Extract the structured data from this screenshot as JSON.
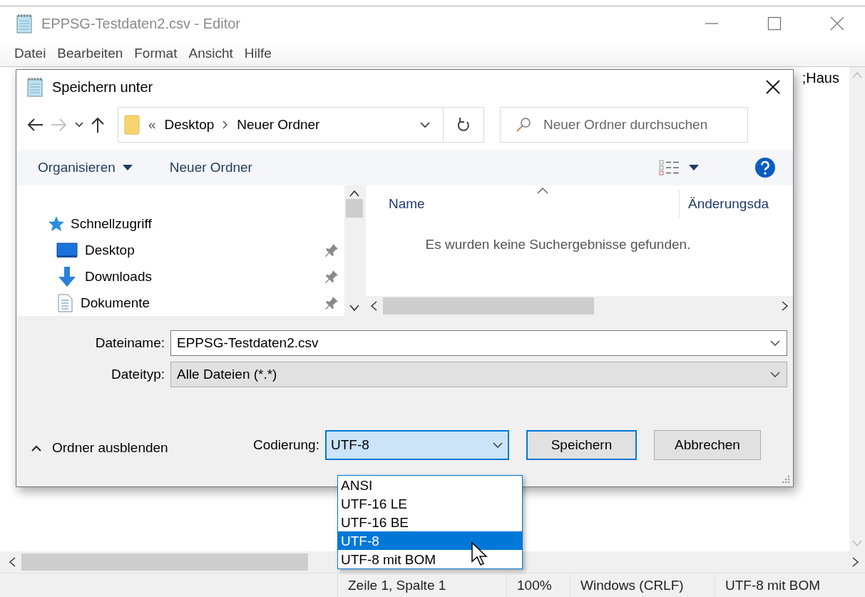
{
  "editor": {
    "title": "EPPSG-Testdaten2.csv - Editor",
    "menu": [
      "Datei",
      "Bearbeiten",
      "Format",
      "Ansicht",
      "Hilfe"
    ],
    "text": ";Haus",
    "status_bar": [
      "Zeile 1, Spalte 1",
      "100%",
      "Windows (CRLF)",
      "UTF-8 mit BOM"
    ]
  },
  "dialog": {
    "title": "Speichern unter",
    "nav_buttons": [
      {
        "kind": "back",
        "disabled": false
      },
      {
        "kind": "forward",
        "disabled": true
      },
      {
        "kind": "recent",
        "disabled": false
      },
      {
        "kind": "up",
        "disabled": false
      }
    ],
    "breadcrumb": {
      "overflow": "«",
      "parts": [
        "Desktop",
        "Neuer Ordner"
      ]
    },
    "search": {
      "placeholder": "Neuer Ordner durchsuchen"
    },
    "toolbar": [
      {
        "label": "Organisieren",
        "dropdown": true
      },
      {
        "label": "Neuer Ordner",
        "dropdown": false
      }
    ],
    "sidebar": {
      "items": [
        {
          "label": "Schnellzugriff",
          "kind": "star",
          "children": [
            {
              "label": "Desktop",
              "kind": "desktop",
              "pinned": true
            },
            {
              "label": "Downloads",
              "kind": "download",
              "pinned": true
            },
            {
              "label": "Dokumente",
              "kind": "document",
              "pinned": true
            }
          ]
        }
      ]
    },
    "file_list": {
      "columns": [
        "Name",
        "Änderungsda"
      ],
      "empty_message": "Es wurden keine Suchergebnisse gefunden."
    },
    "fields": [
      {
        "label": "Dateiname:",
        "value": "EPPSG-Testdaten2.csv",
        "kind": "edit"
      },
      {
        "label": "Dateityp:",
        "value": "Alle Dateien  (*.*)",
        "kind": "select"
      }
    ],
    "hide_folders": "Ordner ausblenden",
    "encoding": {
      "label": "Codierung:",
      "value": "UTF-8",
      "expanded": true,
      "options": [
        {
          "label": "ANSI",
          "selected": false
        },
        {
          "label": "UTF-16 LE",
          "selected": false
        },
        {
          "label": "UTF-16 BE",
          "selected": false
        },
        {
          "label": "UTF-8",
          "selected": true
        },
        {
          "label": "UTF-8 mit BOM",
          "selected": false
        }
      ]
    },
    "buttons": [
      {
        "label": "Speichern",
        "default": true
      },
      {
        "label": "Abbrechen",
        "default": false
      }
    ]
  }
}
